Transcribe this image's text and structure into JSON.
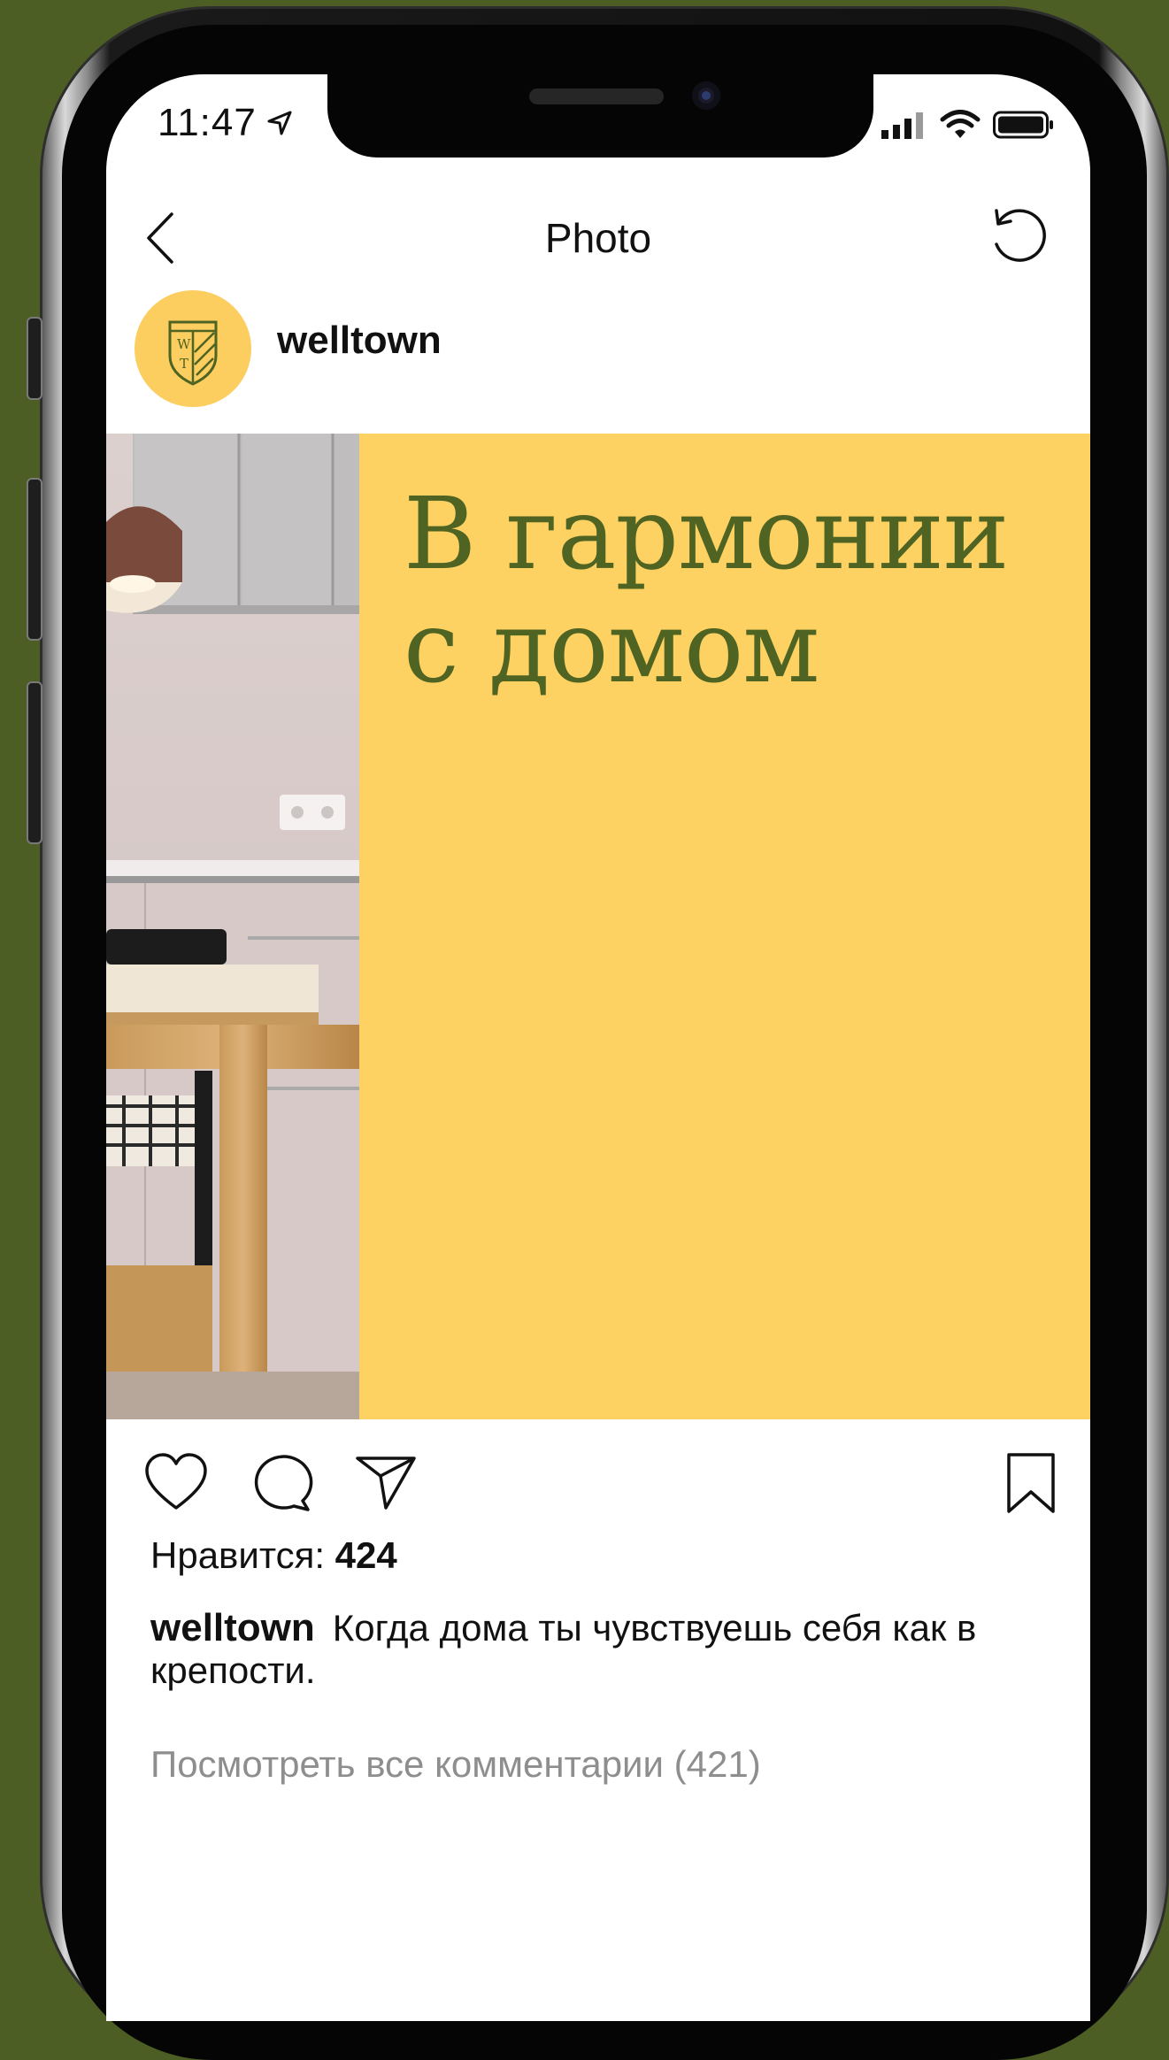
{
  "status_bar": {
    "time": "11:47"
  },
  "nav": {
    "title": "Photo"
  },
  "post": {
    "username": "welltown",
    "avatar_logo_text": "WT",
    "headline_line1": "В гармонии",
    "headline_line2": "с домом"
  },
  "actions": {
    "likes_label": "Нравится:",
    "likes_count": "424"
  },
  "caption": {
    "username": "welltown",
    "text": "Когда дома ты чувствуешь себя как в крепости."
  },
  "comments": {
    "view_all": "Посмотреть все комментарии (421)"
  },
  "colors": {
    "background": "#4c5e24",
    "post_yellow": "#fdd263",
    "headline_green": "#4f6322",
    "avatar_yellow": "#fccd5f"
  }
}
